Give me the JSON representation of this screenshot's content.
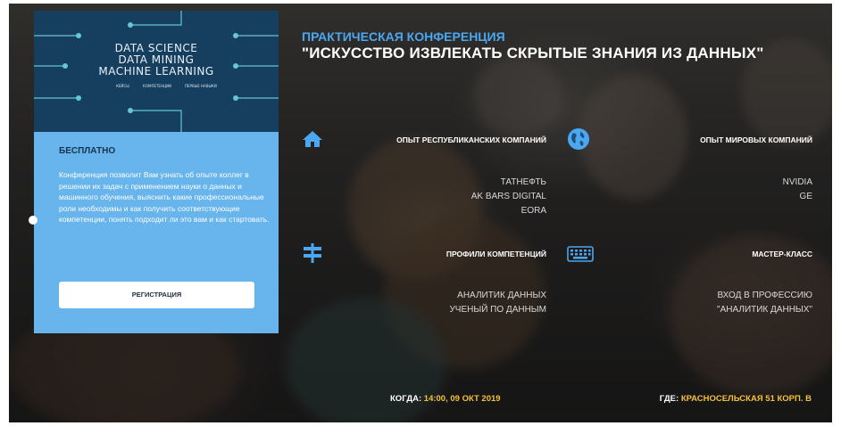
{
  "brand_colors": {
    "accent_blue": "#4aa7f0",
    "card_dark": "#163e5e",
    "card_light": "#68b4ec",
    "highlight_yellow": "#f5c133"
  },
  "card": {
    "title_lines": [
      "DATA  SCIENCE",
      "DATA  MINING",
      "MACHINE  LEARNING"
    ],
    "subtitle_items": [
      "кейсы",
      "компетенции",
      "первые навыки"
    ],
    "free_label": "БЕСПЛАТНО",
    "description": "Конференция позволит Вам узнать об опыте коллег в решении их задач с применением науки о данных и машинного обучения, выяснить какие профессиональные роли необходимы и как получить соответствующие компетенции, понять подходит ли это вам и как стартовать.",
    "register_label": "РЕГИСТРАЦИЯ"
  },
  "header": {
    "kicker": "ПРАКТИЧЕСКАЯ КОНФЕРЕНЦИЯ",
    "title": "\"ИСКУССТВО ИЗВЛЕКАТЬ СКРЫТЫЕ ЗНАНИЯ ИЗ ДАННЫХ\""
  },
  "sections": {
    "republic": {
      "icon": "home-icon",
      "heading": "ОПЫТ РЕСПУБЛИКАНСКИХ КОМПАНИЙ",
      "items": [
        "ТАТНЕФТЬ",
        "AK BARS DIGITAL",
        "EORA"
      ]
    },
    "world": {
      "icon": "globe-icon",
      "heading": "ОПЫТ МИРОВЫХ КОМПАНИЙ",
      "items": [
        "NVIDIA",
        "GE"
      ]
    },
    "profiles": {
      "icon": "signpost-icon",
      "heading": "ПРОФИЛИ КОМПЕТЕНЦИЙ",
      "items": [
        "АНАЛИТИК ДАННЫХ",
        "УЧЕНЫЙ ПО ДАННЫМ"
      ]
    },
    "masterclass": {
      "icon": "keyboard-icon",
      "heading": "МАСТЕР-КЛАСС",
      "items": [
        "ВХОД В ПРОФЕССИЮ",
        "\"АНАЛИТИК ДАННЫХ\""
      ]
    }
  },
  "footer": {
    "when_label": "КОГДА:",
    "when_value": "14:00, 09 ОКТ 2019",
    "where_label": "ГДЕ:",
    "where_value": "КРАСНОСЕЛЬСКАЯ 51 КОРП. В"
  }
}
